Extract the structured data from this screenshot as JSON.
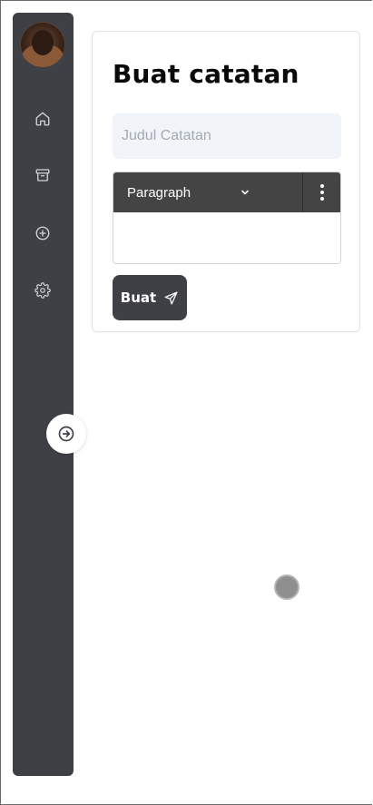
{
  "sidebar": {
    "avatar_alt": "",
    "items": [
      {
        "icon": "home-icon"
      },
      {
        "icon": "archive-icon"
      },
      {
        "icon": "plus-circle-icon"
      },
      {
        "icon": "gear-icon"
      }
    ],
    "expand_icon": "arrow-right-circle-icon"
  },
  "form": {
    "title": "Buat catatan",
    "title_placeholder": "Judul Catatan",
    "title_value": "",
    "editor": {
      "block_type": "Paragraph",
      "body": ""
    },
    "submit_label": "Buat"
  },
  "colors": {
    "sidebar_bg": "#3f4045",
    "input_bg": "#f1f4f9",
    "toolbar_bg": "#444444",
    "button_bg": "#3f4045"
  }
}
